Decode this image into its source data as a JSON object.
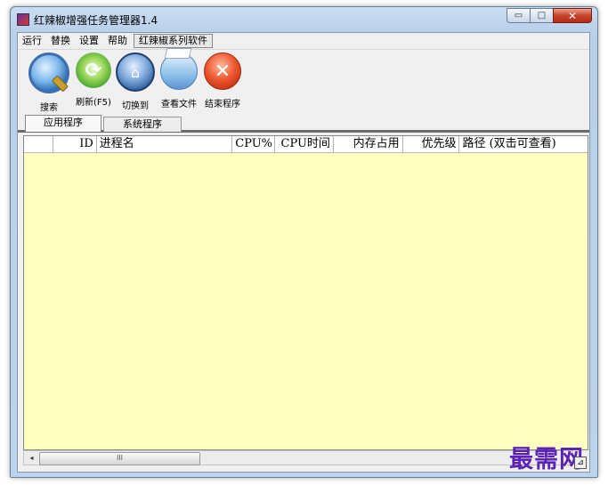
{
  "window": {
    "title": "红辣椒增强任务管理器1.4",
    "icon": "app-icon"
  },
  "caption_buttons": {
    "minimize": "▭",
    "maximize": "□",
    "close": "✕"
  },
  "menu": {
    "items": [
      "运行",
      "替换",
      "设置",
      "帮助",
      "红辣椒系列软件"
    ]
  },
  "toolbar": {
    "buttons": [
      {
        "label": "搜索",
        "icon": "search-icon"
      },
      {
        "label": "刷新(F5)",
        "icon": "refresh-icon"
      },
      {
        "label": "切换到",
        "icon": "switch-to-icon"
      },
      {
        "label": "查看文件",
        "icon": "folder-icon"
      },
      {
        "label": "结束程序",
        "icon": "end-process-icon"
      }
    ]
  },
  "tabs": [
    {
      "label": "应用程序",
      "active": true
    },
    {
      "label": "系统程序",
      "active": false
    }
  ],
  "list": {
    "columns": [
      "",
      "ID",
      "进程名",
      "CPU%",
      "CPU时间",
      "内存占用",
      "优先级",
      "路径 (双击可查看)"
    ],
    "rows": [],
    "background_color": "#ffffc0"
  },
  "scrollbar": {
    "left_arrow": "◂",
    "thumb_grip": "III"
  },
  "watermark": "最需网"
}
